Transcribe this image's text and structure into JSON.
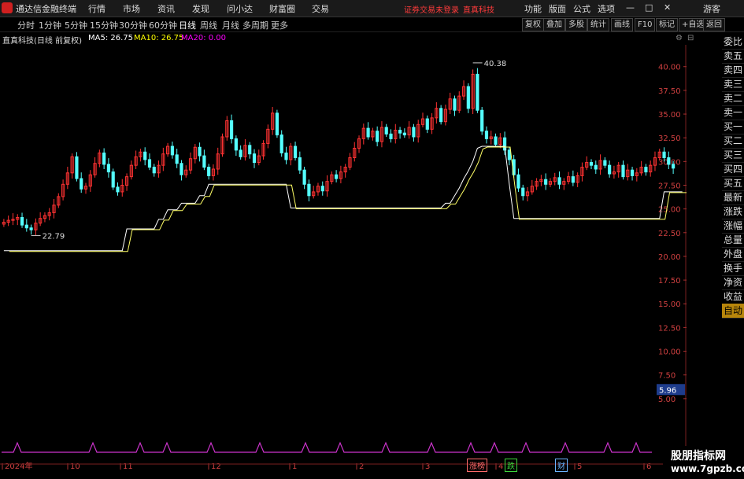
{
  "app": {
    "title": "通达信金融终端"
  },
  "menu": [
    "行情",
    "市场",
    "资讯",
    "发现",
    "问小达",
    "财富圈",
    "交易"
  ],
  "notice": "证券交易未登录",
  "notice_stock": "直真科技",
  "right_menu": [
    "功能",
    "版面",
    "公式",
    "选项"
  ],
  "window_controls": {
    "min": "—",
    "max": "□",
    "close": "✕"
  },
  "guest": "游客",
  "periods": [
    "分时",
    "1分钟",
    "5分钟",
    "15分钟",
    "30分钟",
    "60分钟",
    "日线",
    "周线",
    "月线",
    "多周期",
    "更多"
  ],
  "active_period": "日线",
  "tools": [
    "复权",
    "叠加",
    "多股",
    "统计",
    "画线",
    "F10",
    "标记",
    "+自选",
    "返回"
  ],
  "legend": {
    "stock": "直真科技(日线 前复权)",
    "ma5": "MA5: 26.75",
    "ma10": "MA10: 26.75",
    "ma20": "MA20: 0.00",
    "colors": {
      "ma5": "#ffffff",
      "ma10": "#ffff00",
      "ma20": "#ff00ff"
    }
  },
  "side_panel": [
    "委比",
    "卖五",
    "卖四",
    "卖三",
    "卖二",
    "卖一",
    "买一",
    "买二",
    "买三",
    "买四",
    "买五",
    "最新",
    "涨跌",
    "涨幅",
    "总量",
    "外盘",
    "换手",
    "净资",
    "收益",
    "自动"
  ],
  "watermark": {
    "line1": "股朋指标网",
    "line2": "www.7gpzb.com"
  },
  "markers": [
    "涨榜",
    "跌",
    "财"
  ],
  "chart_data": {
    "type": "candlestick",
    "y_ticks": [
      40.0,
      37.5,
      35.0,
      32.5,
      30.0,
      27.5,
      25.0,
      22.5,
      20.0,
      17.5,
      15.0,
      12.5,
      10.0,
      7.5,
      5.0
    ],
    "ylim": [
      2.5,
      42.3
    ],
    "current_price_label": "5.96",
    "annotations": {
      "high": "40.38",
      "low": "22.79"
    },
    "x_labels": [
      "2024年",
      "10",
      "11",
      "12",
      "1",
      "2",
      "3",
      "4",
      "5",
      "6"
    ],
    "close": [
      23.6,
      23.8,
      23.9,
      24.1,
      23.3,
      23.0,
      22.8,
      23.5,
      24.0,
      24.3,
      24.6,
      25.4,
      26.3,
      27.6,
      28.8,
      30.5,
      28.2,
      27.1,
      27.4,
      28.6,
      29.8,
      30.9,
      29.7,
      28.9,
      27.3,
      26.8,
      27.5,
      28.4,
      29.6,
      30.5,
      31.0,
      30.2,
      29.4,
      28.8,
      29.6,
      30.8,
      31.6,
      30.7,
      29.8,
      28.6,
      29.1,
      30.3,
      31.5,
      30.6,
      29.4,
      28.5,
      29.2,
      30.8,
      32.6,
      34.3,
      32.4,
      31.2,
      30.5,
      31.7,
      30.8,
      29.9,
      30.6,
      31.9,
      33.4,
      35.1,
      32.8,
      30.9,
      30.2,
      31.6,
      30.4,
      29.1,
      27.6,
      26.4,
      26.8,
      27.4,
      26.9,
      27.9,
      28.6,
      28.2,
      28.9,
      29.4,
      30.4,
      31.4,
      32.4,
      33.5,
      32.6,
      33.2,
      32.1,
      33.6,
      32.9,
      32.4,
      33.3,
      33.0,
      32.8,
      33.6,
      32.6,
      33.9,
      34.5,
      33.4,
      34.6,
      35.6,
      34.2,
      35.5,
      36.6,
      35.4,
      36.9,
      37.9,
      35.6,
      39.2,
      35.4,
      33.2,
      32.4,
      32.6,
      31.8,
      32.5,
      31.2,
      30.2,
      28.6,
      27.2,
      26.4,
      26.8,
      27.4,
      27.9,
      28.1,
      27.6,
      27.9,
      28.3,
      27.6,
      27.9,
      28.4,
      27.8,
      28.5,
      29.4,
      29.9,
      29.6,
      29.2,
      30.1,
      29.6,
      28.7,
      28.9,
      29.6,
      28.4,
      29.1,
      28.5,
      28.8,
      29.4,
      28.9,
      29.6,
      30.4,
      31.0,
      30.4,
      29.7,
      29.3
    ],
    "ma_band": [
      20.6,
      20.6,
      20.6,
      20.6,
      20.6,
      20.6,
      20.6,
      20.6,
      20.6,
      20.6,
      20.6,
      20.6,
      20.6,
      20.6,
      20.6,
      20.6,
      20.6,
      20.6,
      20.6,
      20.6,
      20.6,
      20.6,
      20.6,
      20.6,
      20.6,
      20.6,
      20.6,
      22.9,
      22.9,
      22.9,
      22.9,
      22.9,
      22.9,
      22.9,
      23.9,
      23.9,
      24.9,
      24.9,
      24.9,
      25.6,
      25.6,
      25.6,
      25.6,
      26.4,
      26.4,
      27.6,
      27.6,
      27.6,
      27.6,
      27.6,
      27.6,
      27.6,
      27.6,
      27.6,
      27.6,
      27.6,
      27.6,
      27.6,
      27.6,
      27.6,
      27.6,
      27.6,
      27.6,
      25.1,
      25.1,
      25.1,
      25.1,
      25.1,
      25.1,
      25.1,
      25.1,
      25.1,
      25.1,
      25.1,
      25.1,
      25.1,
      25.1,
      25.1,
      25.1,
      25.1,
      25.1,
      25.1,
      25.1,
      25.1,
      25.1,
      25.1,
      25.1,
      25.1,
      25.1,
      25.1,
      25.1,
      25.1,
      25.1,
      25.1,
      25.1,
      25.1,
      25.1,
      25.6,
      25.6,
      26.4,
      27.2,
      28.2,
      29.0,
      30.0,
      31.4,
      31.6,
      31.6,
      31.6,
      31.6,
      31.6,
      31.6,
      27.6,
      24.0,
      24.0,
      24.0,
      24.0,
      24.0,
      24.0,
      24.0,
      24.0,
      24.0,
      24.0,
      24.0,
      24.0,
      24.0,
      24.0,
      24.0,
      24.0,
      24.0,
      24.0,
      24.0,
      24.0,
      24.0,
      24.0,
      24.0,
      24.0,
      24.0,
      24.0,
      24.0,
      24.0,
      24.0,
      24.0,
      24.0,
      24.0,
      24.0,
      26.8,
      26.8,
      26.8,
      26.8,
      26.8
    ]
  }
}
